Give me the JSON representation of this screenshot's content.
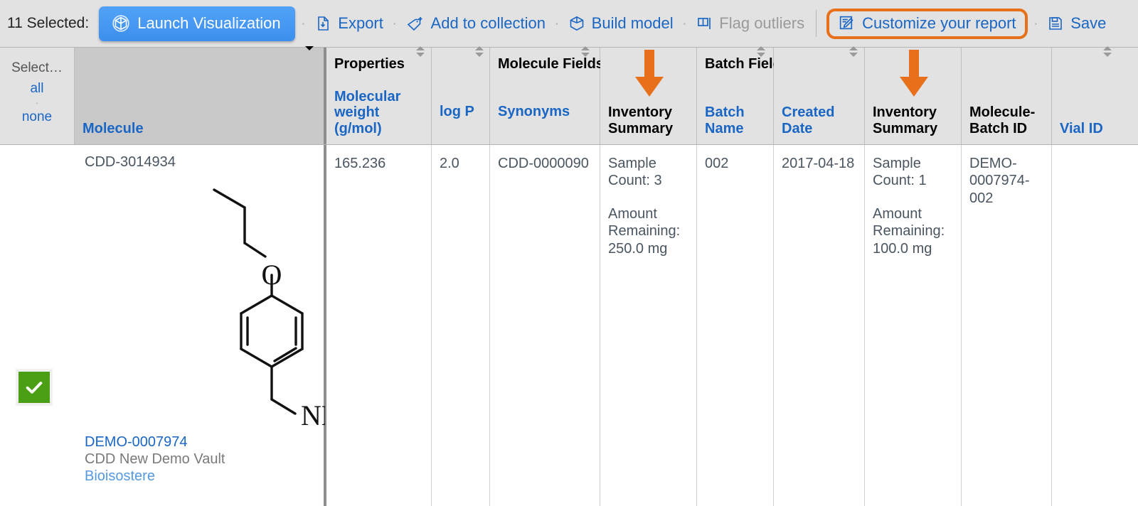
{
  "toolbar": {
    "selected_count_label": "11 Selected:",
    "launch_label": "Launch Visualization",
    "separator": "·",
    "items": [
      {
        "label": "Export",
        "icon": "export-file-icon",
        "disabled": false
      },
      {
        "label": "Add to collection",
        "icon": "tag-plus-icon",
        "disabled": false
      },
      {
        "label": "Build model",
        "icon": "cube-icon",
        "disabled": false
      },
      {
        "label": "Flag outliers",
        "icon": "flag-icon",
        "disabled": true
      }
    ],
    "customize_label": "Customize your report",
    "customize_icon": "report-pencil-icon",
    "save_label": "Save",
    "save_icon": "floppy-disk-icon",
    "highlight_color": "#e8701a",
    "accent_blue": "#1a66c4",
    "button_blue": "#3d8fee"
  },
  "select_column": {
    "label": "Select…",
    "all": "all",
    "dot": "·",
    "none": "none",
    "checked": true,
    "check_color": "#4a9f14"
  },
  "groups": {
    "properties": "Properties",
    "molecule_fields": "Molecule Fields",
    "batch_fields": "Batch Fields"
  },
  "columns": [
    {
      "key": "molecule",
      "title": "Molecule",
      "sortable": true,
      "plain": false,
      "active": true
    },
    {
      "key": "mw",
      "title": "Molecular weight (g/mol)",
      "sortable": true,
      "plain": false
    },
    {
      "key": "logp",
      "title": "log P",
      "sortable": true,
      "plain": false
    },
    {
      "key": "synonyms",
      "title": "Synonyms",
      "sortable": true,
      "plain": false
    },
    {
      "key": "inv_mol",
      "title": "Inventory Summary",
      "sortable": false,
      "plain": true
    },
    {
      "key": "batchname",
      "title": "Batch Name",
      "sortable": true,
      "plain": false
    },
    {
      "key": "created",
      "title": "Created Date",
      "sortable": true,
      "plain": false
    },
    {
      "key": "inv_batch",
      "title": "Inventory Summary",
      "sortable": false,
      "plain": true
    },
    {
      "key": "mbid",
      "title": "Molecule-Batch ID",
      "sortable": false,
      "plain": true
    },
    {
      "key": "vial",
      "title": "Vial ID",
      "sortable": true,
      "plain": false
    }
  ],
  "row": {
    "molecule_id": "CDD-3014934",
    "vault_id": "DEMO-0007974",
    "vault_name": "CDD New Demo Vault",
    "project": "Bioisostere",
    "molecular_weight": "165.236",
    "log_p": "2.0",
    "synonyms": "CDD-0000090",
    "inventory_molecule_sample": "Sample Count: 3",
    "inventory_molecule_amount": "Amount Remaining: 250.0 mg",
    "batch_name": "002",
    "created_date": "2017-04-18",
    "inventory_batch_sample": "Sample Count: 1",
    "inventory_batch_amount": "Amount Remaining: 100.0 mg",
    "molecule_batch_id": "DEMO-0007974-002",
    "vial_id": ""
  },
  "annotations": {
    "arrow_color": "#e8701a",
    "arrow_targets": [
      "inventory-summary-molecule-header",
      "inventory-summary-batch-header"
    ]
  }
}
